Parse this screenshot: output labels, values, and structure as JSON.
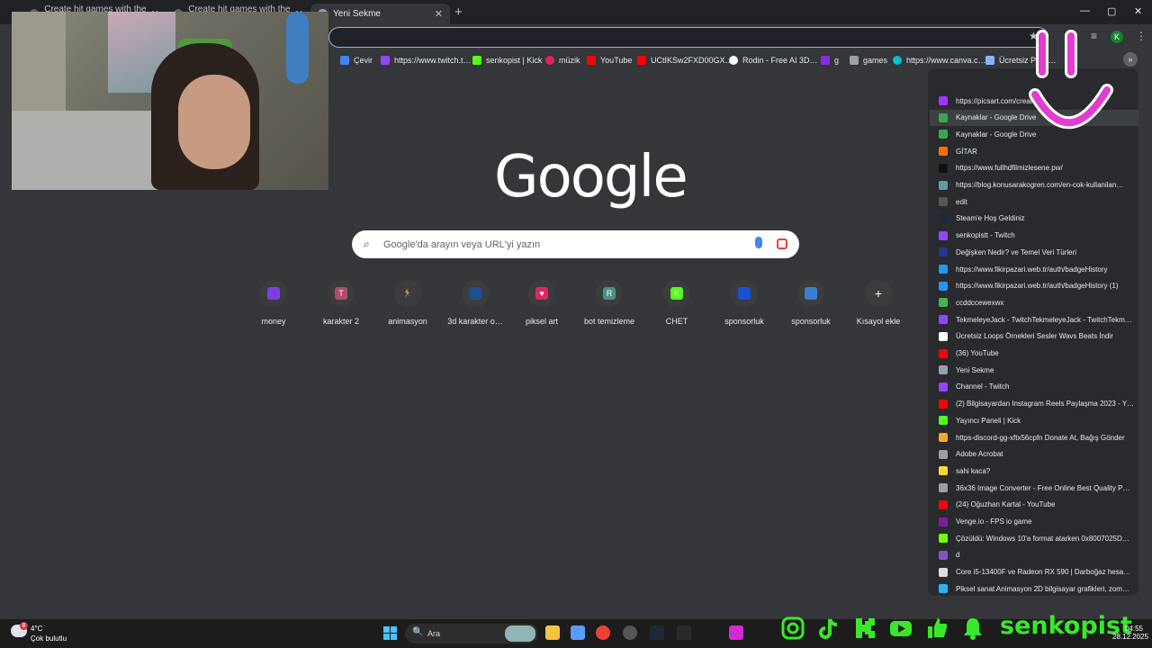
{
  "tabs": [
    {
      "title": "Create hit games with the po…",
      "active": false
    },
    {
      "title": "Create hit games with the po…",
      "active": false
    },
    {
      "title": "Yeni Sekme",
      "active": true
    }
  ],
  "new_tab_glyph": "+",
  "window_controls": {
    "minimize": "—",
    "maximize": "▢",
    "close": "✕"
  },
  "bookmarks": [
    {
      "label": "Çevir",
      "icon": "google-translate-icon",
      "color": "#4285f4"
    },
    {
      "label": "https://www.twitch.t…",
      "icon": "twitch-icon",
      "color": "#9146ff"
    },
    {
      "label": "senkopist | Kick",
      "icon": "kick-icon",
      "color": "#53fc18"
    },
    {
      "label": "müzik",
      "icon": "music-icon",
      "color": "#e0245e"
    },
    {
      "label": "YouTube",
      "icon": "youtube-icon",
      "color": "#ff0000"
    },
    {
      "label": "UCtIKSw2FXD00GX…",
      "icon": "youtube-icon",
      "color": "#ff0000"
    },
    {
      "label": "Rodin - Free AI 3D…",
      "icon": "rodin-icon",
      "color": "#ffffff"
    },
    {
      "label": "g",
      "icon": "kick-icon",
      "color": "#8a2be2"
    },
    {
      "label": "games",
      "icon": "folder-icon",
      "color": "#9aa0a6"
    },
    {
      "label": "https://www.canva.c…",
      "icon": "canva-icon",
      "color": "#00c4cc"
    },
    {
      "label": "Ücretsiz PNG…",
      "icon": "png-icon",
      "color": "#8ab4f8"
    }
  ],
  "profile_initial": "K",
  "google_logo": "Google",
  "search": {
    "placeholder": "Google'da arayın veya URL'yi yazın"
  },
  "shortcuts": [
    {
      "label": "money",
      "color": "#7b3fe4",
      "glyph": ""
    },
    {
      "label": "karakter 2",
      "color": "#b04a6e",
      "glyph": "T"
    },
    {
      "label": "animasyon",
      "color": "#3c3c3f",
      "glyph": "🏃"
    },
    {
      "label": "3d karakter o…",
      "color": "#1f4f8f",
      "glyph": ""
    },
    {
      "label": "piksel art",
      "color": "#e0245e",
      "glyph": "♥"
    },
    {
      "label": "bot temizleme",
      "color": "#4a8f85",
      "glyph": "R"
    },
    {
      "label": "CHET",
      "color": "#53fc18",
      "glyph": "K"
    },
    {
      "label": "sponsorluk",
      "color": "#1a4fd6",
      "glyph": ""
    },
    {
      "label": "sponsorluk",
      "color": "#3b7fd0",
      "glyph": ""
    },
    {
      "label": "Kısayol ekle",
      "color": "#3c3c3f",
      "glyph": "+"
    }
  ],
  "history": [
    {
      "title": "https://picsart.com/create",
      "color": "#a136ff"
    },
    {
      "title": "Kaynaklar - Google Drive",
      "color": "#34a853"
    },
    {
      "title": "Kaynaklar - Google Drive",
      "color": "#34a853"
    },
    {
      "title": "GİTAR",
      "color": "#ff6d00"
    },
    {
      "title": "https://www.fullhdfilmizlesene.pw/",
      "color": "#111111"
    },
    {
      "title": "https://blog.konusarakogren.com/en-cok-kullanilan…",
      "color": "#5f9ea0"
    },
    {
      "title": "edit",
      "color": "#555555"
    },
    {
      "title": "Steam'e Hoş Geldiniz",
      "color": "#1b2838"
    },
    {
      "title": "senkopistt - Twitch",
      "color": "#9146ff"
    },
    {
      "title": "Değişken Nedir? ve Temel Veri Türleri",
      "color": "#1f3a93"
    },
    {
      "title": "https://www.fikirpazari.web.tr/auth/badgeHistory",
      "color": "#2196f3"
    },
    {
      "title": "https://www.fikirpazari.web.tr/auth/badgeHistory (1)",
      "color": "#2196f3"
    },
    {
      "title": "ccddccewexwx",
      "color": "#4caf50"
    },
    {
      "title": "TekmeleyeJack - TwitchTekmeleyeJack - TwitchTekm…",
      "color": "#9146ff"
    },
    {
      "title": "Ücretsiz Loops Örnekleri Sesler Wavs Beats İndir",
      "color": "#ffffff"
    },
    {
      "title": "(36) YouTube",
      "color": "#ff0000"
    },
    {
      "title": "Yeni Sekme",
      "color": "#9aa0a6"
    },
    {
      "title": "Channel - Twitch",
      "color": "#9146ff"
    },
    {
      "title": "(2) Bilgisayardan Instagram Reels Paylaşma 2023 - Y…",
      "color": "#ff0000"
    },
    {
      "title": "Yayıncı Paneli | Kick",
      "color": "#53fc18"
    },
    {
      "title": "https-discord-gg-xftx56cpfn Donate At, Bağış Gönder",
      "color": "#f9a825"
    },
    {
      "title": "Adobe Acrobat",
      "color": "#9aa0a6"
    },
    {
      "title": "sahi kaca?",
      "color": "#fdd835"
    },
    {
      "title": "36x36 Image Converter - Free Online Best Quality P…",
      "color": "#9aa0a6"
    },
    {
      "title": "(24) Oğuzhan Kartal - YouTube",
      "color": "#ff0000"
    },
    {
      "title": "Venge.io - FPS io game",
      "color": "#7b1fa2"
    },
    {
      "title": "Çözüldü: Windows 10'a format atarken 0x8007025D…",
      "color": "#76ff03"
    },
    {
      "title": "d",
      "color": "#7e57c2"
    },
    {
      "title": "Core i5-13400F ve Radeon RX 590 | Darboğaz hesa…",
      "color": "#dddddd"
    },
    {
      "title": "Piksel sanat Animasyon 2D bilgisayar grafikleri, zom…",
      "color": "#29b6f6"
    }
  ],
  "taskbar": {
    "weather_badge": "8",
    "temperature": "4°C",
    "condition": "Çok bulutlu",
    "search_label": "Ara",
    "search_glyph": "🔍",
    "time": "04:55",
    "date": "28.12.2025"
  },
  "taskbar_apps": [
    {
      "icon": "file-explorer-icon",
      "color": "#f5c542"
    },
    {
      "icon": "store-icon",
      "color": "#5a9cf8"
    },
    {
      "icon": "chrome-icon",
      "color": "#e94235"
    },
    {
      "icon": "obs-icon",
      "color": "#555555"
    },
    {
      "icon": "steam-icon",
      "color": "#1b2838"
    },
    {
      "icon": "epic-games-icon",
      "color": "#2a2a2a"
    },
    {
      "icon": "app-icon",
      "color": "#d52ad5"
    }
  ],
  "overlay": {
    "channel_name": "senkopist"
  }
}
